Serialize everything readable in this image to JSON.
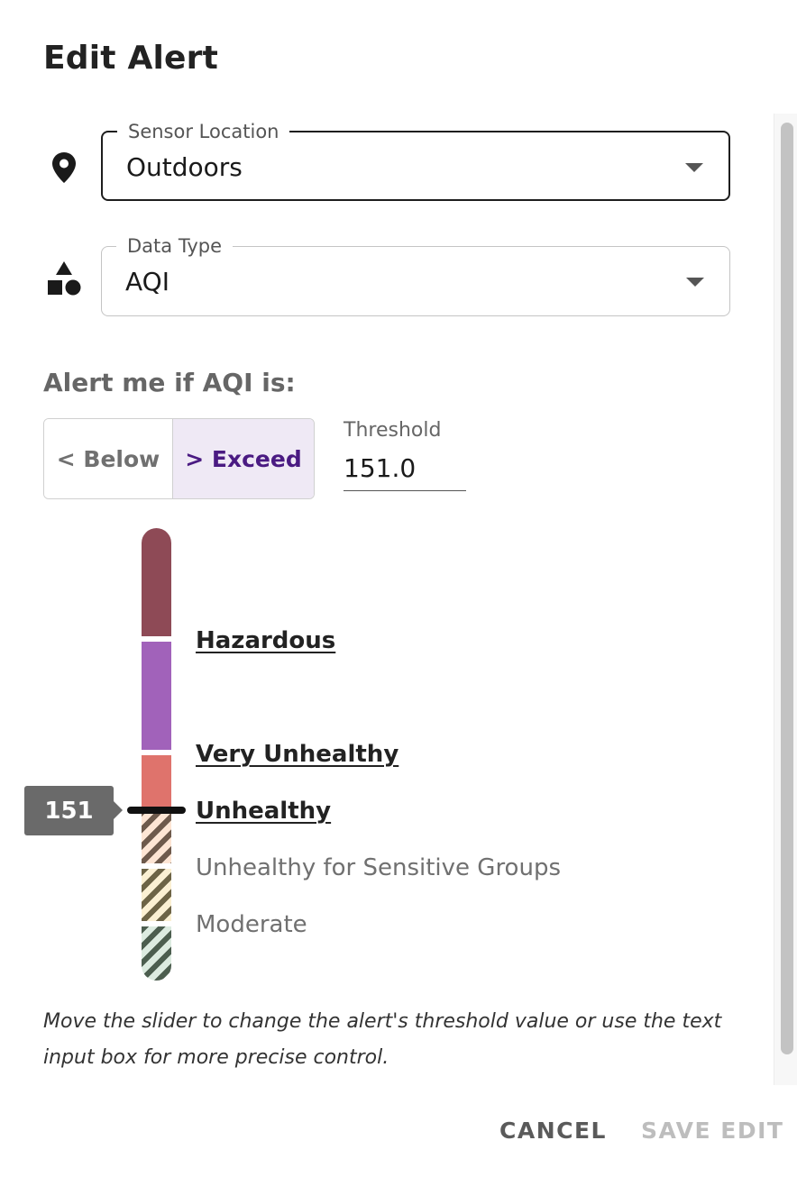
{
  "dialog": {
    "title": "Edit Alert"
  },
  "sensor_location": {
    "label": "Sensor Location",
    "value": "Outdoors",
    "icon": "location-pin-icon"
  },
  "data_type": {
    "label": "Data Type",
    "value": "AQI",
    "icon": "shapes-icon"
  },
  "alert_condition": {
    "label": "Alert me if AQI is:",
    "below_label": "< Below",
    "exceed_label": "> Exceed",
    "selected": "exceed"
  },
  "threshold": {
    "label": "Threshold",
    "value": "151.0"
  },
  "slider": {
    "value_label": "151",
    "levels": [
      {
        "label": "Hazardous",
        "color": "#8e4a56",
        "active": true
      },
      {
        "label": "Very Unhealthy",
        "color": "#a162ba",
        "active": true
      },
      {
        "label": "Unhealthy",
        "color": "#df736c",
        "active": true
      },
      {
        "label": "Unhealthy for Sensitive Groups",
        "color": "#6e5a4c",
        "active": false
      },
      {
        "label": "Moderate",
        "color": "#6d6446",
        "active": false
      }
    ]
  },
  "help_text": "Move the slider to change the alert's threshold value or use the text input box for more precise control.",
  "actions": {
    "cancel_label": "CANCEL",
    "save_label": "SAVE EDIT"
  },
  "colors": {
    "accent_selected_bg": "#efe9f5",
    "accent_selected_text": "#4a1a82"
  }
}
